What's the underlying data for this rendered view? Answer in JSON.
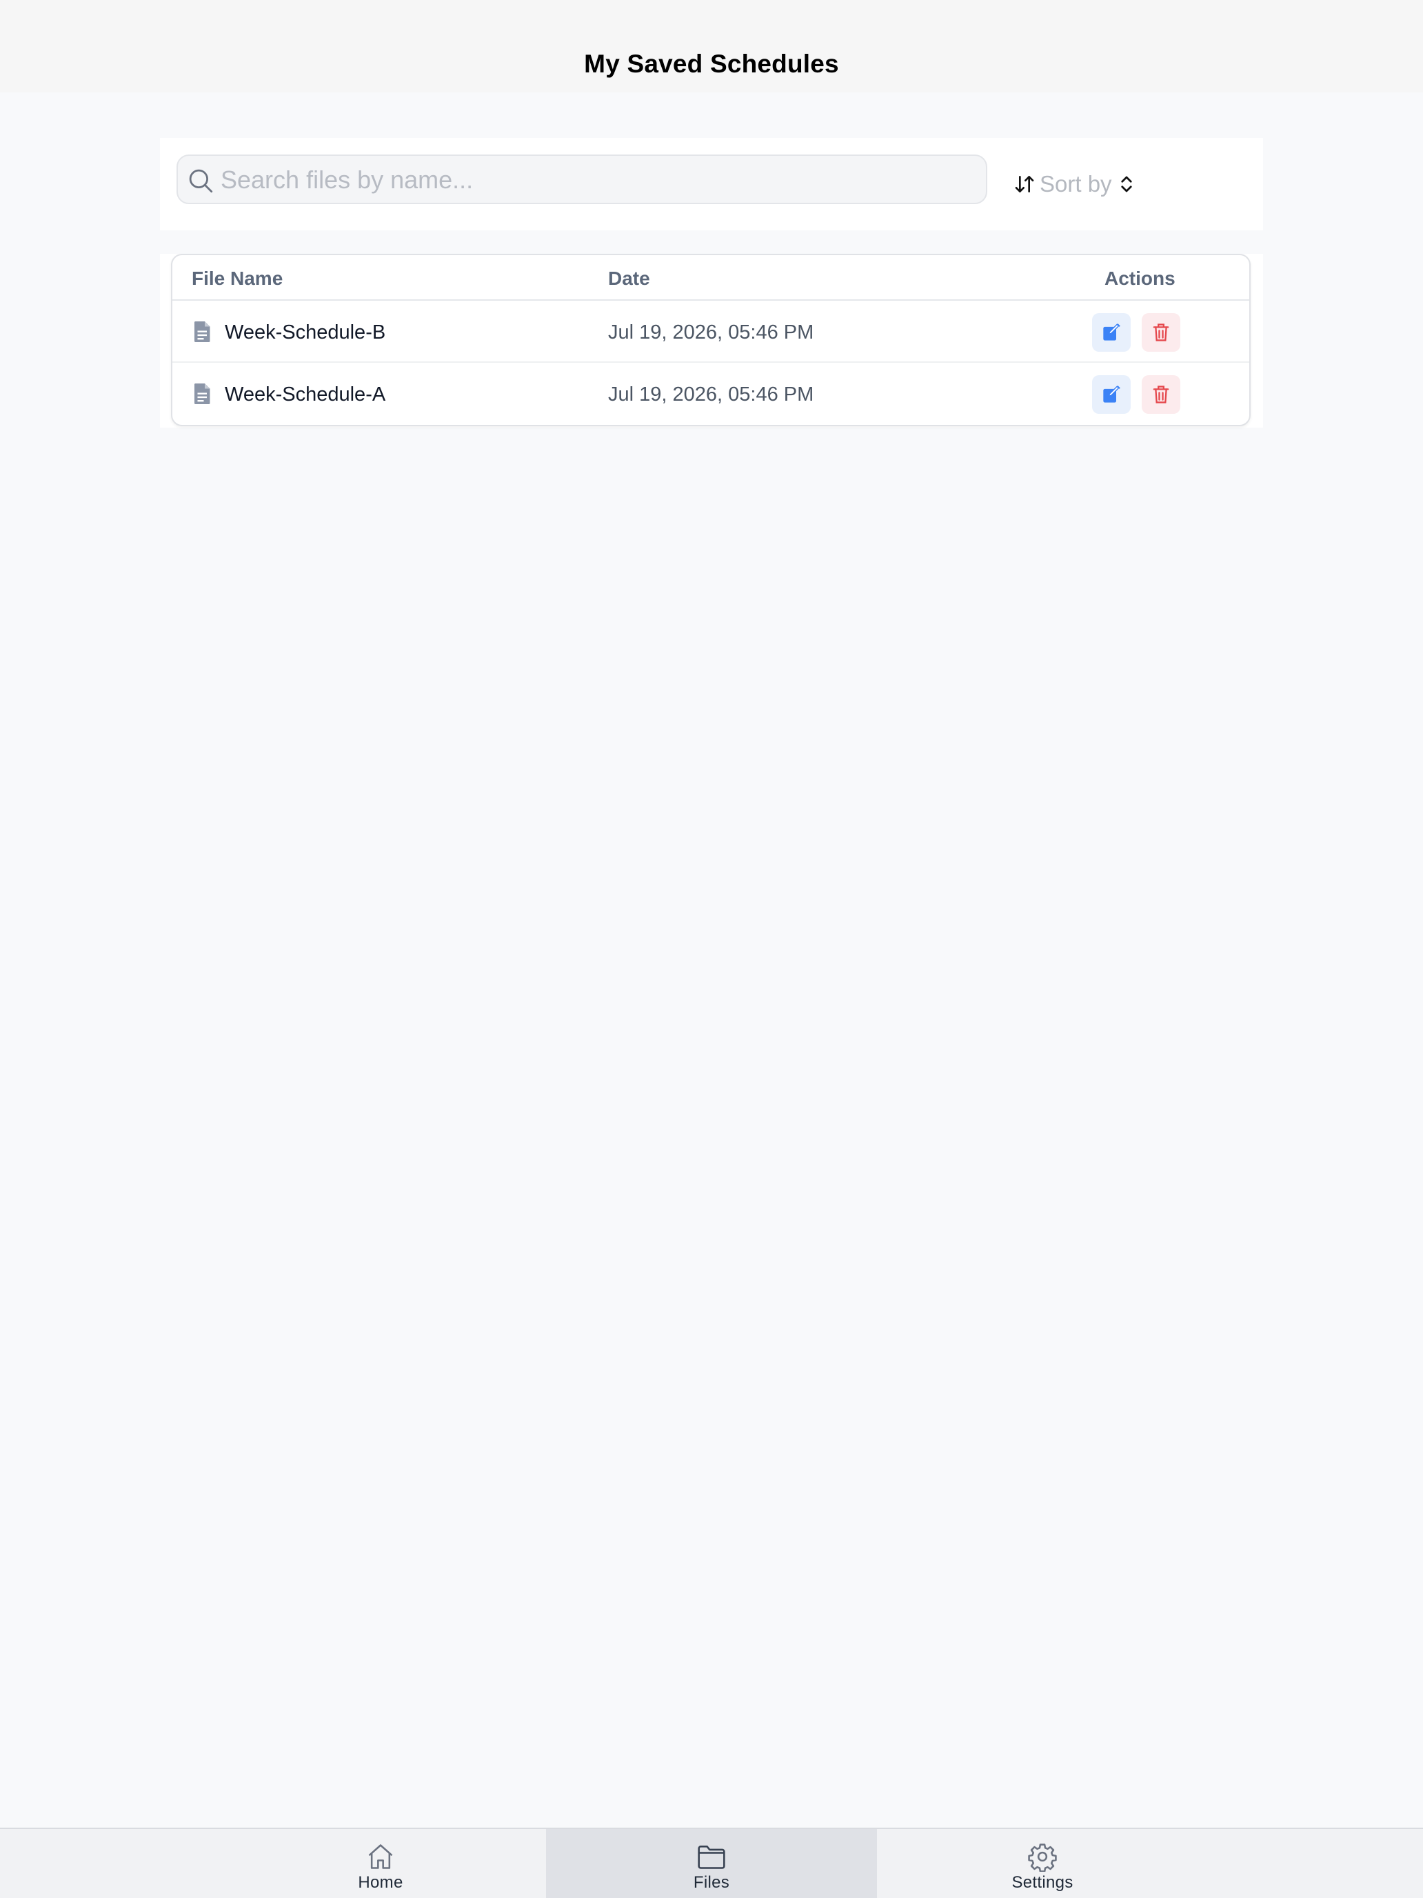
{
  "header": {
    "title": "My Saved Schedules"
  },
  "search": {
    "placeholder": "Search files by name...",
    "value": ""
  },
  "sort": {
    "label": "Sort by"
  },
  "table": {
    "columns": [
      "File Name",
      "Date",
      "Actions"
    ],
    "rows": [
      {
        "name": "Week-Schedule-B",
        "date": "Jul 19, 2026, 05:46 PM"
      },
      {
        "name": "Week-Schedule-A",
        "date": "Jul 19, 2026, 05:46 PM"
      }
    ]
  },
  "tabbar": {
    "items": [
      {
        "label": "Home",
        "icon": "home-icon",
        "active": false
      },
      {
        "label": "Files",
        "icon": "folder-icon",
        "active": true
      },
      {
        "label": "Settings",
        "icon": "gear-icon",
        "active": false
      }
    ]
  },
  "colors": {
    "edit": "#3b82f6",
    "delete": "#e5484d",
    "active_tab": "#dfe1e6"
  }
}
